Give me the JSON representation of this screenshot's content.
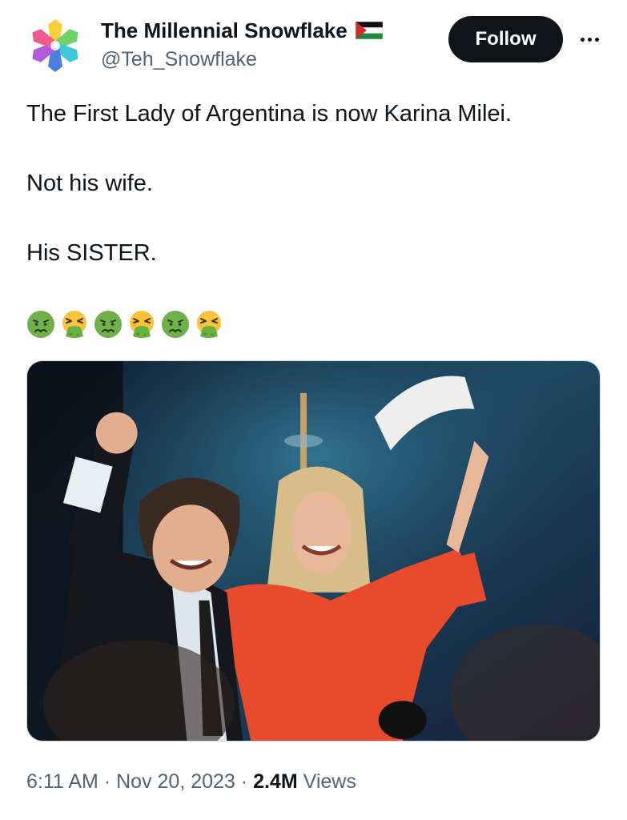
{
  "author": {
    "display_name": "The Millennial Snowflake",
    "handle": "@Teh_Snowflake",
    "avatar_icon": "rainbow-snowflake-icon",
    "flag_icon": "palestine-flag-icon"
  },
  "actions": {
    "follow_label": "Follow",
    "more_icon": "more-dots-icon"
  },
  "tweet": {
    "lines": [
      "The First Lady of Argentina is now Karina Milei.",
      "Not his wife.",
      "His SISTER."
    ],
    "emojis": [
      "nauseated-face",
      "face-vomiting",
      "nauseated-face",
      "face-vomiting",
      "nauseated-face",
      "face-vomiting"
    ]
  },
  "media": {
    "type": "photo",
    "subject": "man in dark suit raising fist beside woman in red top waving papers"
  },
  "meta": {
    "time": "6:11 AM",
    "separator": "·",
    "date": "Nov 20, 2023",
    "views_count": "2.4M",
    "views_label": "Views"
  },
  "colors": {
    "text": "#0f1419",
    "secondary": "#536471",
    "follow_bg": "#0f1419",
    "follow_text": "#ffffff"
  }
}
